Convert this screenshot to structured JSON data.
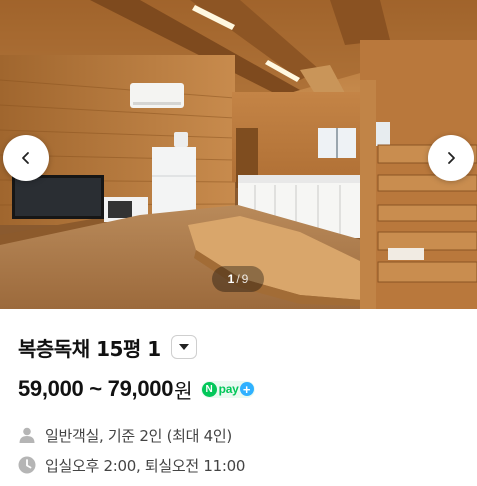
{
  "carousel": {
    "current": "1",
    "separator": "/",
    "total": "9",
    "prev_icon": "chevron-left-icon",
    "next_icon": "chevron-right-icon"
  },
  "room": {
    "title": "복층독채 15평 1",
    "dropdown_icon": "chevron-down-icon",
    "price_range": "59,000 ~ 79,000",
    "price_unit": "원",
    "npay": {
      "mark": "N",
      "label": "pay",
      "plus": "+"
    },
    "capacity": "일반객실, 기준 2인 (최대 4인)",
    "capacity_icon": "person-icon",
    "check_times": "입실오후 2:00, 퇴실오전 11:00",
    "check_icon": "clock-icon"
  },
  "colors": {
    "npay_green": "#03c75a",
    "npay_plus_blue": "#2fb1ff",
    "meta_text": "#444444",
    "icon_gray": "#b5b5b5"
  }
}
